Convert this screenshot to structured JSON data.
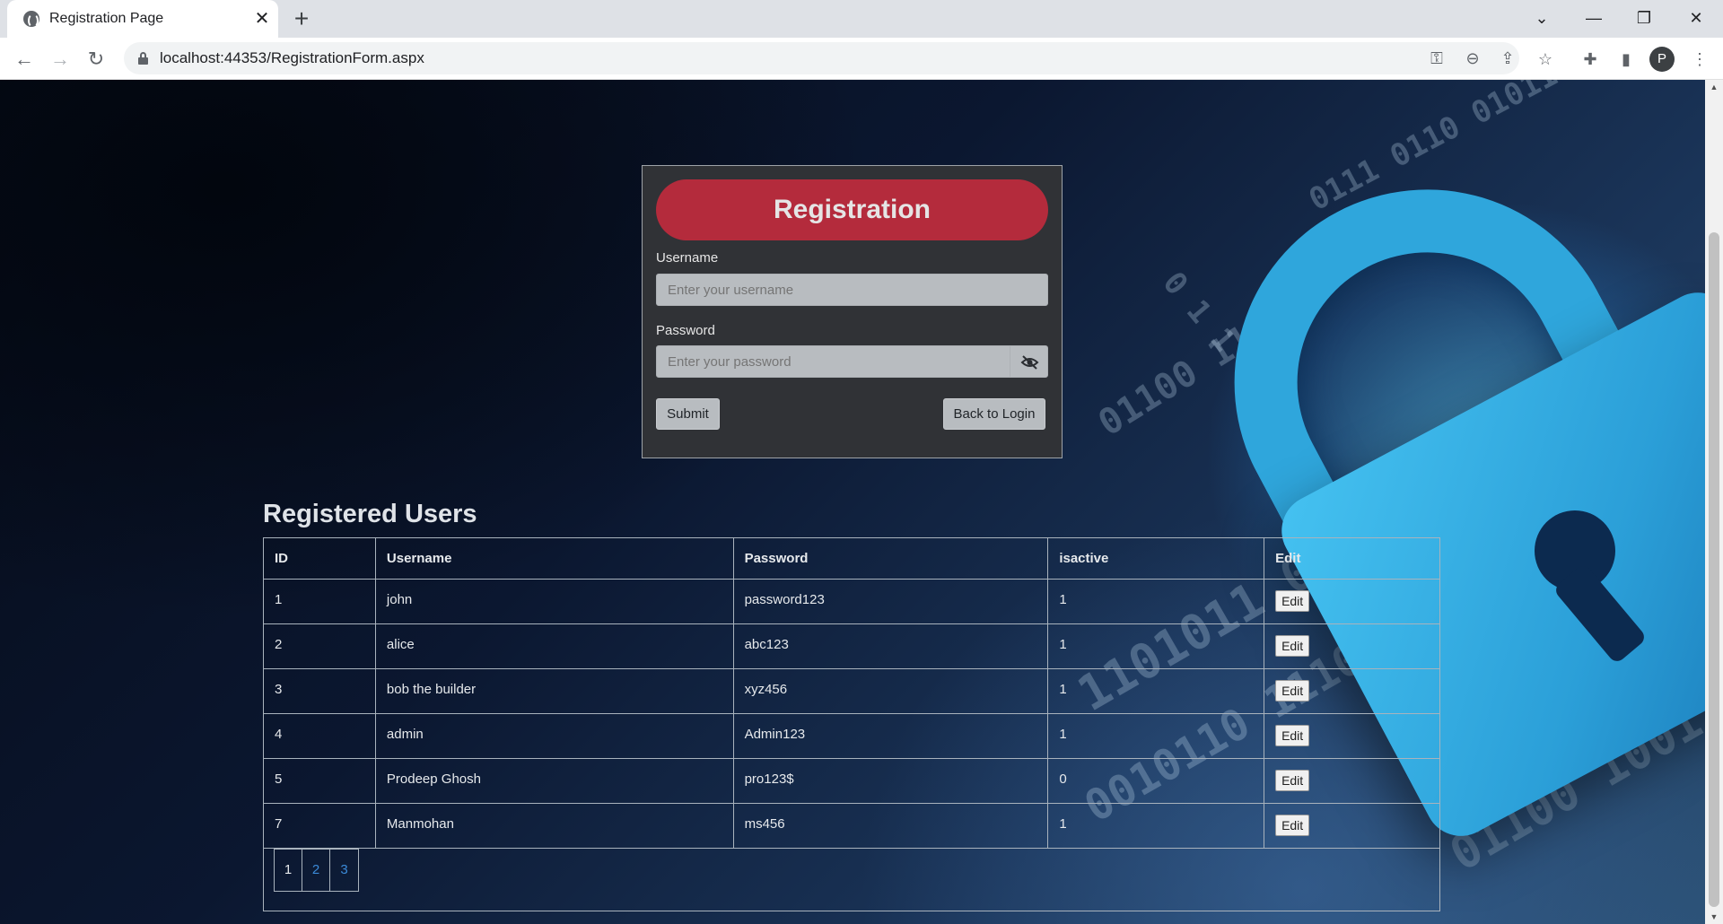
{
  "browser": {
    "tab_title": "Registration Page",
    "url": "localhost:44353/RegistrationForm.aspx",
    "profile_initial": "P"
  },
  "registration": {
    "title": "Registration",
    "username_label": "Username",
    "username_placeholder": "Enter your username",
    "password_label": "Password",
    "password_placeholder": "Enter your password",
    "submit_label": "Submit",
    "back_label": "Back to Login"
  },
  "users": {
    "title": "Registered Users",
    "columns": [
      "ID",
      "Username",
      "Password",
      "isactive",
      "Edit"
    ],
    "rows": [
      {
        "id": "1",
        "username": "john",
        "password": "password123",
        "isactive": "1",
        "edit": "Edit"
      },
      {
        "id": "2",
        "username": "alice",
        "password": "abc123",
        "isactive": "1",
        "edit": "Edit"
      },
      {
        "id": "3",
        "username": "bob the builder",
        "password": "xyz456",
        "isactive": "1",
        "edit": "Edit"
      },
      {
        "id": "4",
        "username": "admin",
        "password": "Admin123",
        "isactive": "1",
        "edit": "Edit"
      },
      {
        "id": "5",
        "username": "Prodeep Ghosh",
        "password": "pro123$",
        "isactive": "0",
        "edit": "Edit"
      },
      {
        "id": "7",
        "username": "Manmohan",
        "password": "ms456",
        "isactive": "1",
        "edit": "Edit"
      }
    ],
    "pages": [
      "1",
      "2",
      "3"
    ],
    "current_page": "1"
  },
  "colors": {
    "header_red": "#b42b3c",
    "card_bg": "#303236",
    "link_blue": "#3b8ad8"
  }
}
